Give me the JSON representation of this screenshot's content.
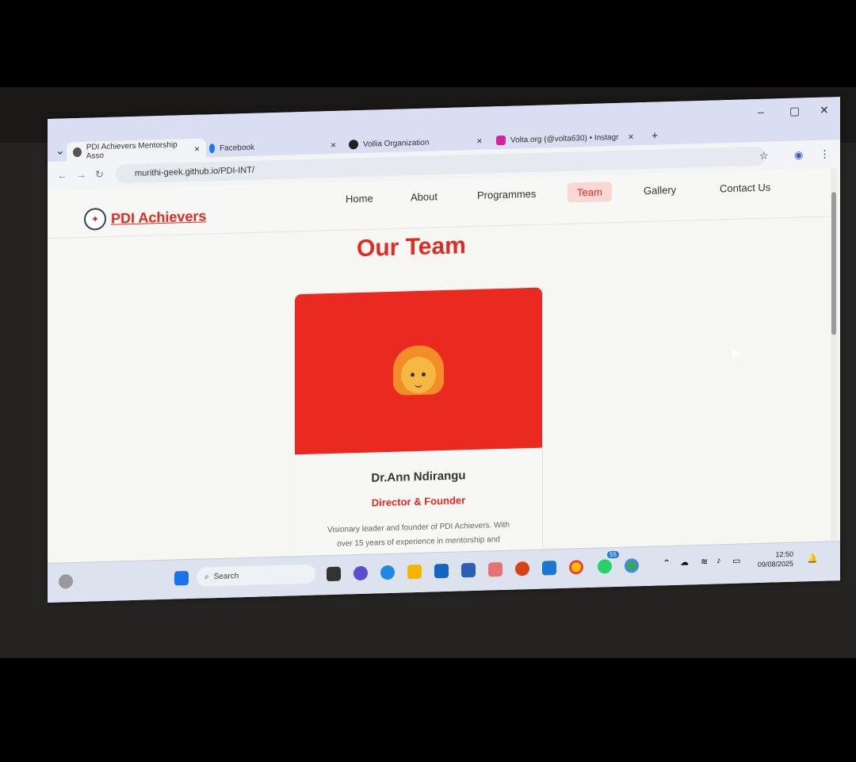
{
  "browser": {
    "tabs": [
      {
        "title": "PDI Achievers Mentorship Asso",
        "close": "×"
      },
      {
        "title": "Facebook",
        "close": "×"
      },
      {
        "title": "Vollia Organization",
        "close": "×"
      },
      {
        "title": "Volta.org (@volta630) • Instagr",
        "close": "×"
      }
    ],
    "new_tab": "+",
    "url": "murithi-geek.github.io/PDI-INT/",
    "window_controls": {
      "minimize": "–",
      "maximize": "▢",
      "close": "✕"
    }
  },
  "site": {
    "logo_text": "PDI Achievers",
    "nav": [
      "Home",
      "About",
      "Programmes",
      "Team",
      "Gallery",
      "Contact Us"
    ],
    "active_nav": "Team",
    "heading": "Our Team",
    "member": {
      "name": "Dr.Ann Ndirangu",
      "role": "Director & Founder",
      "bio_line1": "Visionary leader and founder of PDI Achievers. With",
      "bio_line2": "over 15 years of experience in mentorship and"
    }
  },
  "taskbar": {
    "search_label": "Search",
    "time": "12:50",
    "date": "09/08/2025",
    "whatsapp_badge": "55"
  },
  "colors": {
    "accent": "#e42a1e",
    "card": "#ea2a20"
  },
  "icons": [
    "back-icon",
    "forward-icon",
    "reload-icon",
    "star-icon",
    "profile-icon",
    "menu-dots-icon",
    "windows-start-icon",
    "search-icon",
    "chrome-icon",
    "whatsapp-icon",
    "wifi-icon",
    "volume-icon",
    "battery-icon",
    "notification-icon"
  ]
}
